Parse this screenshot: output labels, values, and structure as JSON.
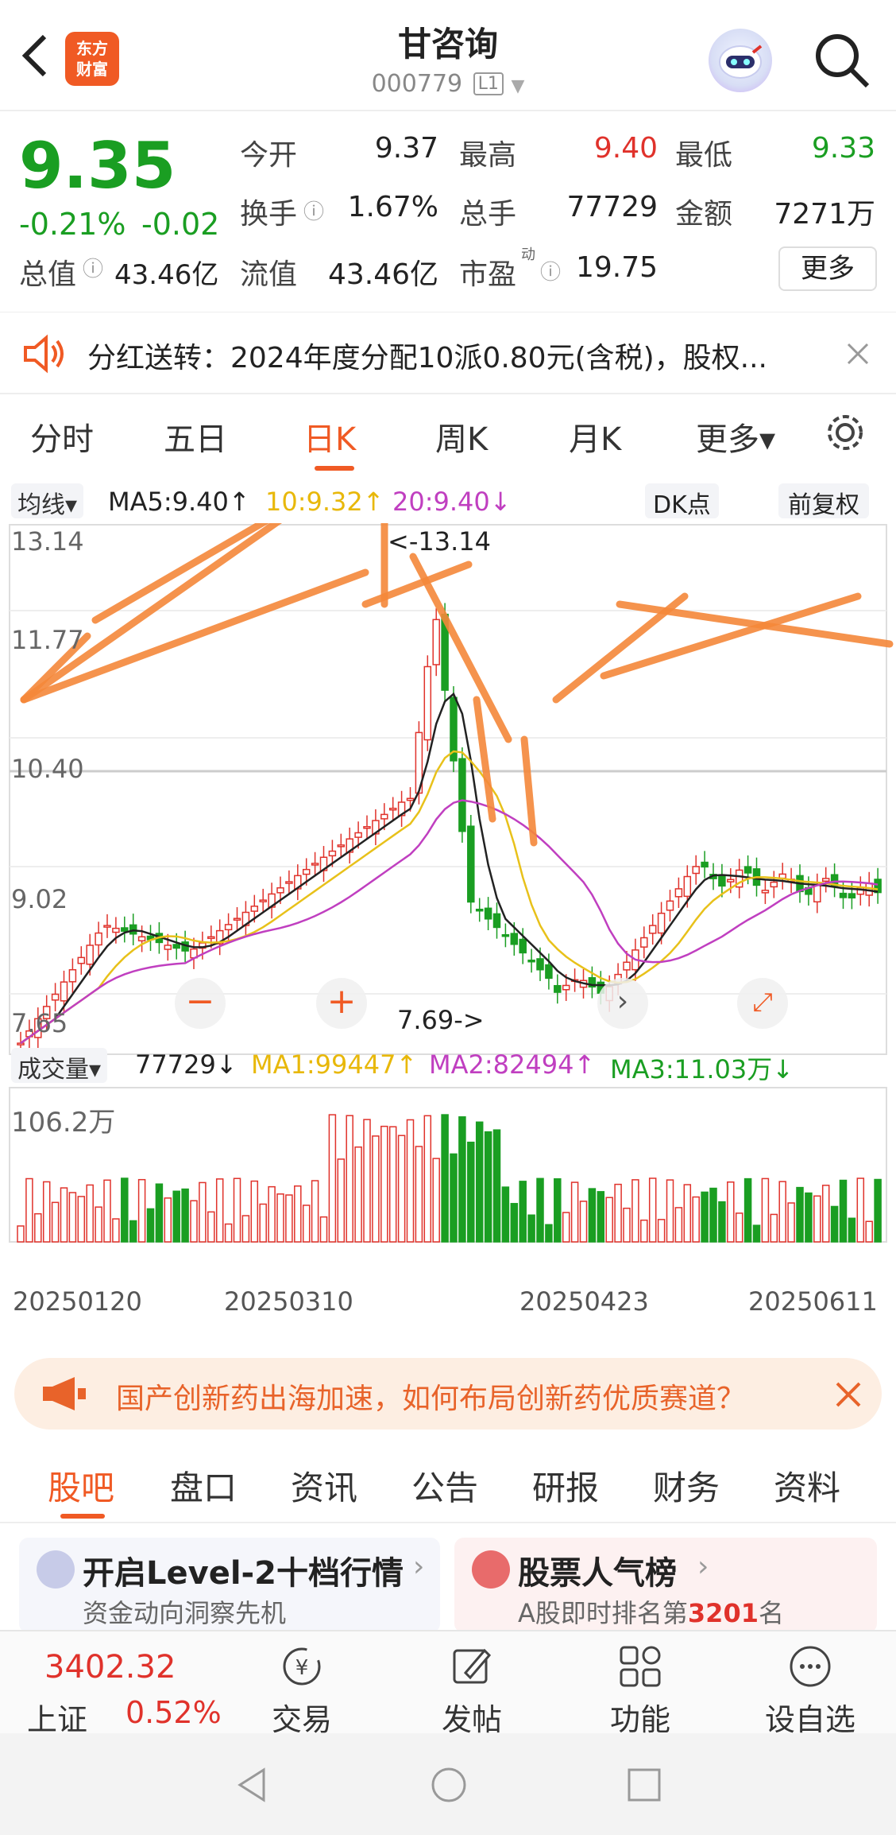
{
  "header": {
    "logo_text_1": "东方",
    "logo_text_2": "财富",
    "title": "甘咨询",
    "code": "000779",
    "level_tag": "L1"
  },
  "quote": {
    "price": "9.35",
    "change_pct": "-0.21%",
    "change_abs": "-0.02",
    "total_value_label": "总值",
    "total_value": "43.46亿",
    "rows": [
      [
        {
          "label": "今开",
          "value": "9.37",
          "color": "#222222"
        },
        {
          "label": "最高",
          "value": "9.40",
          "color": "#e0322b"
        },
        {
          "label": "最低",
          "value": "9.33",
          "color": "#1a9e22"
        }
      ],
      [
        {
          "label": "换手",
          "value": "1.67%",
          "color": "#222222"
        },
        {
          "label": "总手",
          "value": "77729",
          "color": "#222222"
        },
        {
          "label": "金额",
          "value": "7271万",
          "color": "#222222"
        }
      ],
      [
        {
          "label": "流值",
          "value": "43.46亿",
          "color": "#222222"
        },
        {
          "label": "市盈",
          "value": "19.75",
          "color": "#222222"
        }
      ]
    ],
    "pe_superscript": "动",
    "more_button": "更多"
  },
  "notice": {
    "text": "分红送转：2024年度分配10派0.80元(含税)，股权..."
  },
  "period_tabs": [
    {
      "label": "分时",
      "active": false
    },
    {
      "label": "五日",
      "active": false
    },
    {
      "label": "日K",
      "active": true
    },
    {
      "label": "周K",
      "active": false
    },
    {
      "label": "月K",
      "active": false
    },
    {
      "label": "更多▾",
      "active": false
    }
  ],
  "ma_bar": {
    "selector": "均线▾",
    "ma5": "MA5:9.40↑",
    "ma10": "10:9.32↑",
    "ma20": "20:9.40↓",
    "dk_button": "DK点",
    "adjust_button": "前复权"
  },
  "vol_bar": {
    "selector": "成交量▾",
    "volume": "77729↓",
    "ma1": "MA1:99447↑",
    "ma2": "MA2:82494↑",
    "ma3": "MA3:11.03万↓",
    "vol_max": "106.2万"
  },
  "chart_data": {
    "type": "candlestick",
    "y_ticks": [
      "13.14",
      "11.77",
      "10.40",
      "9.02",
      "7.65"
    ],
    "ylim": [
      7.65,
      13.14
    ],
    "high_marker": "<-13.14",
    "low_marker": "7.69->",
    "x_ticks": [
      "20250120",
      "20250310",
      "20250423",
      "20250611"
    ],
    "colors": {
      "up": "#e0322b",
      "down": "#1a9e22",
      "ma5": "#222222",
      "ma10": "#e8c11a",
      "ma20": "#c03fc0",
      "annotation": "#f5883a"
    }
  },
  "ad": {
    "text": "国产创新药出海加速，如何布局创新药优质赛道？"
  },
  "bottom_tabs": [
    {
      "label": "股吧",
      "active": true
    },
    {
      "label": "盘口",
      "active": false
    },
    {
      "label": "资讯",
      "active": false
    },
    {
      "label": "公告",
      "active": false
    },
    {
      "label": "研报",
      "active": false
    },
    {
      "label": "财务",
      "active": false
    },
    {
      "label": "资料",
      "active": false
    }
  ],
  "cards": [
    {
      "title": "开启Level-2十档行情",
      "sub": "资金动向洞察先机"
    },
    {
      "title": "股票人气榜",
      "sub_prefix": "A股即时排名第",
      "sub_rank": "3201",
      "sub_suffix": "名"
    }
  ],
  "bottom_bar": {
    "index_value": "3402.32",
    "index_name": "上证",
    "index_change": "0.52%",
    "items": [
      {
        "label": "交易",
        "icon": "yen-cycle-icon"
      },
      {
        "label": "发帖",
        "icon": "edit-icon"
      },
      {
        "label": "功能",
        "icon": "grid-icon"
      },
      {
        "label": "设自选",
        "icon": "more-circle-icon"
      }
    ]
  }
}
